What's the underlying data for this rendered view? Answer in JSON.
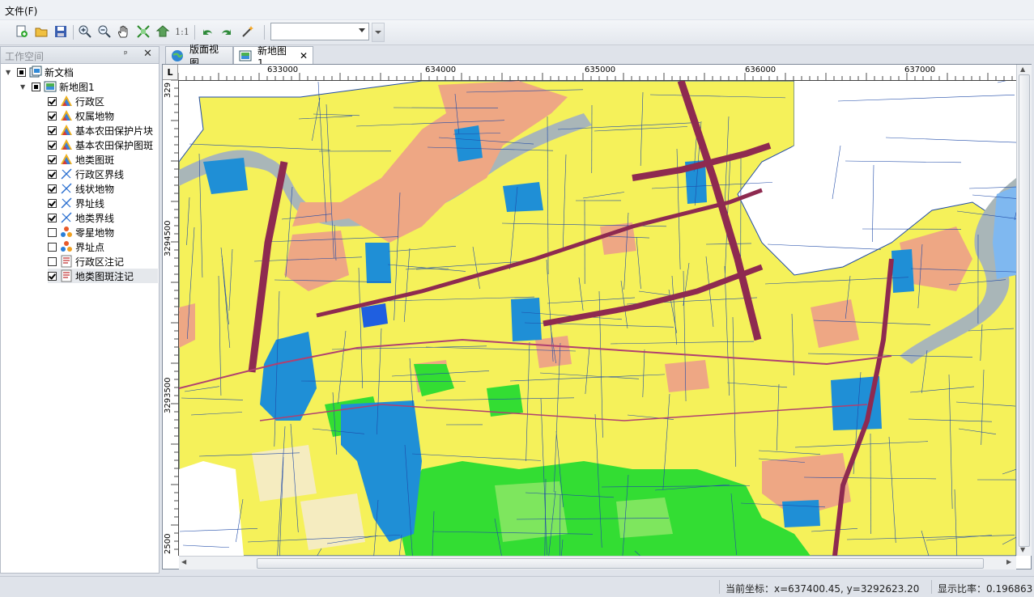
{
  "menu": {
    "file": "文件(F)"
  },
  "toolbar": {
    "buttons": [
      "new-layer-icon",
      "open-icon",
      "save-icon",
      "zoom-in-icon",
      "zoom-out-icon",
      "pan-icon",
      "full-extent-icon",
      "refresh-icon",
      "one-to-one",
      "undo-icon",
      "redo-icon",
      "magic-wand-icon"
    ],
    "one_to_one_label": "1:1",
    "scale_value": ""
  },
  "workspace": {
    "title": "工作空间",
    "pin": "ᵖ",
    "close": "✕",
    "root": {
      "label": "新文档"
    },
    "map": {
      "label": "新地图1"
    },
    "layers": [
      {
        "label": "行政区",
        "checked": true,
        "icon": "polygon-layer-icon"
      },
      {
        "label": "权属地物",
        "checked": true,
        "icon": "polygon-layer-icon"
      },
      {
        "label": "基本农田保护片块",
        "checked": true,
        "icon": "polygon-layer-icon"
      },
      {
        "label": "基本农田保护图斑",
        "checked": true,
        "icon": "polygon-layer-icon"
      },
      {
        "label": "地类图斑",
        "checked": true,
        "icon": "polygon-layer-icon"
      },
      {
        "label": "行政区界线",
        "checked": true,
        "icon": "line-layer-icon"
      },
      {
        "label": "线状地物",
        "checked": true,
        "icon": "line-layer-icon"
      },
      {
        "label": "界址线",
        "checked": true,
        "icon": "line-layer-icon"
      },
      {
        "label": "地类界线",
        "checked": true,
        "icon": "line-layer-icon"
      },
      {
        "label": "零星地物",
        "checked": false,
        "icon": "point-layer-icon"
      },
      {
        "label": "界址点",
        "checked": false,
        "icon": "point-layer-icon"
      },
      {
        "label": "行政区注记",
        "checked": false,
        "icon": "annotation-layer-icon"
      },
      {
        "label": "地类图斑注记",
        "checked": true,
        "icon": "annotation-layer-icon"
      }
    ]
  },
  "tabs": [
    {
      "label": "版面视图",
      "active": false
    },
    {
      "label": "新地图1",
      "active": true,
      "close": "✕"
    }
  ],
  "ruler": {
    "corner": "L",
    "top_labels": [
      "633000",
      "634000",
      "635000",
      "636000",
      "637000"
    ],
    "left_labels": [
      "329",
      "3294500",
      "3293500",
      "2500"
    ]
  },
  "status": {
    "coordinate": "当前坐标：x=637400.45, y=3292623.20",
    "scale": "显示比率：0.196863"
  },
  "colors": {
    "farmland": "#f5f15a",
    "construction": "#eea784",
    "water": "#1f8fd6",
    "forest": "#33dd33",
    "road": "#8e2a50",
    "river": "#a9b6b8",
    "parcel_line": "#1f4aa8"
  }
}
